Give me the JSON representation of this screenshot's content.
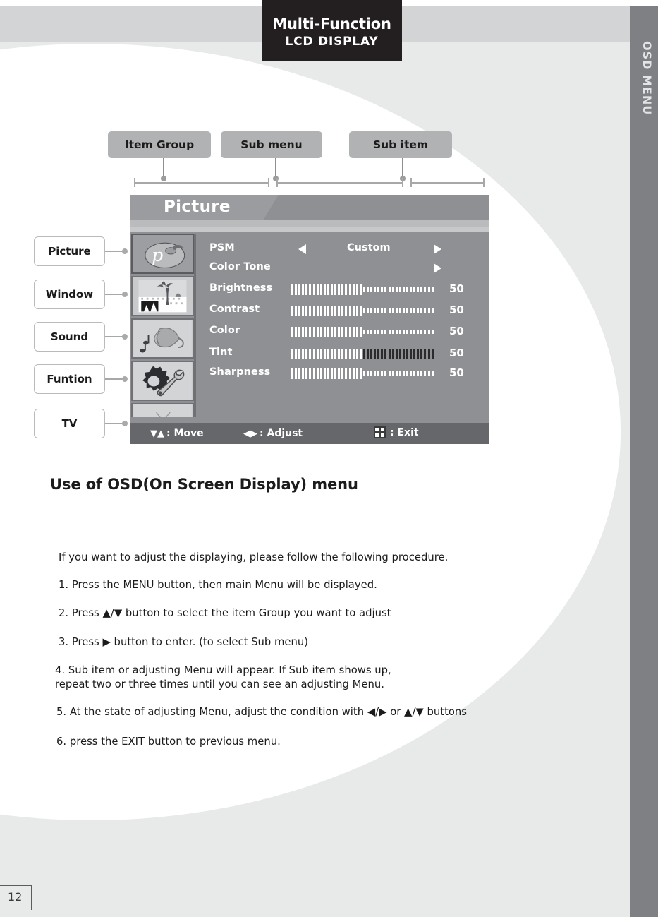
{
  "header": {
    "title_line1": "Multi-Function",
    "title_line2": "LCD DISPLAY",
    "side_tab_label": "OSD MENU"
  },
  "callouts": [
    {
      "label": "Item Group"
    },
    {
      "label": "Sub menu"
    },
    {
      "label": "Sub item"
    }
  ],
  "item_groups": [
    {
      "label": "Picture",
      "icon": "palette-icon"
    },
    {
      "label": "Window",
      "icon": "palm-scene-icon"
    },
    {
      "label": "Sound",
      "icon": "speaker-music-icon"
    },
    {
      "label": "Funtion",
      "icon": "gear-wrench-icon"
    },
    {
      "label": "TV",
      "icon": "tv-set-icon"
    }
  ],
  "osd": {
    "title": "Picture",
    "rows": [
      {
        "label": "PSM",
        "type": "option",
        "value": "Custom",
        "left_arrow": true,
        "right_arrow": true
      },
      {
        "label": "Color Tone",
        "type": "submenu",
        "value": "",
        "left_arrow": false,
        "right_arrow": true
      },
      {
        "label": "Brightness",
        "type": "slider",
        "value": "50",
        "filled": 20,
        "total": 40,
        "style": "normal"
      },
      {
        "label": "Contrast",
        "type": "slider",
        "value": "50",
        "filled": 20,
        "total": 40,
        "style": "normal"
      },
      {
        "label": "Color",
        "type": "slider",
        "value": "50",
        "filled": 20,
        "total": 40,
        "style": "normal"
      },
      {
        "label": "Tint",
        "type": "slider",
        "value": "50",
        "filled": 20,
        "total": 40,
        "style": "dark-tail"
      },
      {
        "label": "Sharpness",
        "type": "slider",
        "value": "50",
        "filled": 20,
        "total": 40,
        "style": "normal"
      }
    ],
    "hints": {
      "move": ": Move",
      "move_glyph": "▼▲",
      "adjust": ": Adjust",
      "adjust_glyph": "◀▶",
      "exit": ": Exit",
      "exit_icon": "menu-grid-icon"
    }
  },
  "body": {
    "heading": "Use of OSD(On Screen Display) menu",
    "intro": "If you want to adjust the displaying, please follow the following procedure.",
    "steps": [
      "1. Press the MENU button, then main Menu will be displayed.",
      "2. Press  ▲/▼  button to select the item Group you want to adjust",
      "3. Press ▶ button to enter. (to select Sub menu)",
      "4. Sub item or adjusting Menu will appear. If Sub item shows up,\n repeat two or three times until you can see an adjusting Menu.",
      "5. At the state of adjusting Menu, adjust the condition with ◀/▶  or  ▲/▼  buttons",
      "6. press the EXIT button to previous menu."
    ]
  },
  "footer": {
    "page_number": "12"
  },
  "colors": {
    "osd_body": "#8e9093",
    "osd_title": "#9a9c9f",
    "osd_bottom": "#65676a",
    "side_tab": "#7e8083",
    "chip": "#b0b2b4",
    "plaque": "#231f20",
    "page_bg": "#e8eaea"
  }
}
